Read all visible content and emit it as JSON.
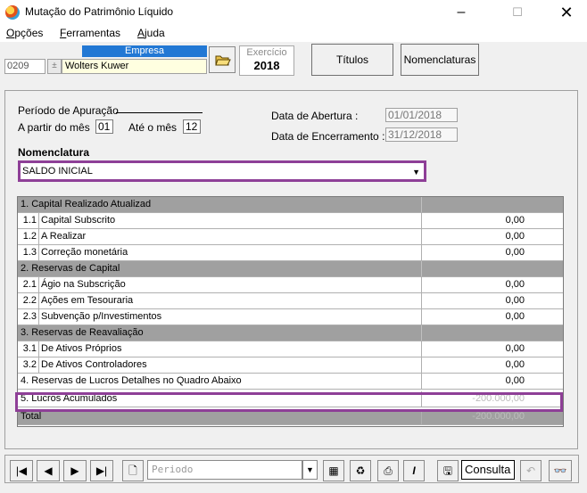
{
  "window": {
    "title": "Mutação do Patrimônio Líquido"
  },
  "menu": {
    "items": [
      "Opções",
      "Ferramentas",
      "Ajuda"
    ],
    "underline_first": [
      "O",
      "F",
      "A"
    ]
  },
  "header": {
    "empresa_label": "Empresa",
    "empresa_code": "0209",
    "empresa_name": "Wolters Kuwer",
    "exercicio_label": "Exercício",
    "exercicio_year": "2018",
    "titulos_label": "Títulos",
    "nomenclaturas_label": "Nomenclaturas"
  },
  "period": {
    "title": "Período de Apuração",
    "from_label": "A partir do mês",
    "from_value": "01",
    "to_label": "Até o mês",
    "to_value": "12"
  },
  "dates": {
    "abertura_label": "Data de Abertura :",
    "abertura_value": "01/01/2018",
    "encerramento_label": "Data de Encerramento :",
    "encerramento_value": "31/12/2018"
  },
  "nomenclatura": {
    "label": "Nomenclatura",
    "selected": "SALDO INICIAL"
  },
  "table": {
    "rows": [
      {
        "type": "group",
        "desc": "1. Capital Realizado Atualizad",
        "amount": ""
      },
      {
        "type": "item",
        "num": "1.1",
        "desc": "Capital Subscrito",
        "amount": "0,00"
      },
      {
        "type": "item",
        "num": "1.2",
        "desc": "A Realizar",
        "amount": "0,00"
      },
      {
        "type": "item",
        "num": "1.3",
        "desc": "Correção monetária",
        "amount": "0,00"
      },
      {
        "type": "group",
        "desc": "2. Reservas  de Capital",
        "amount": ""
      },
      {
        "type": "item",
        "num": "2.1",
        "desc": "Ágio na Subscrição",
        "amount": "0,00"
      },
      {
        "type": "item",
        "num": "2.2",
        "desc": "Ações em Tesouraria",
        "amount": "0,00"
      },
      {
        "type": "item",
        "num": "2.3",
        "desc": "Subvenção p/Investimentos",
        "amount": "0,00"
      },
      {
        "type": "group",
        "desc": "3. Reservas de Reavaliação",
        "amount": ""
      },
      {
        "type": "item",
        "num": "3.1",
        "desc": "De Ativos Próprios",
        "amount": "0,00"
      },
      {
        "type": "item",
        "num": "3.2",
        "desc": "De Ativos Controladores",
        "amount": "0,00"
      },
      {
        "type": "plain",
        "desc": "4. Reservas de Lucros Detalhes no Quadro Abaixo",
        "amount": "0,00"
      },
      {
        "type": "lucros",
        "desc": "5. Lucros Acumulados",
        "amount": "-200.000,00"
      },
      {
        "type": "total",
        "desc": "Total",
        "amount": "-200.000,00"
      }
    ]
  },
  "statusbar": {
    "periodo_placeholder": "Periodo",
    "consulta_label": "Consulta"
  },
  "colors": {
    "highlight": "#8e3f97",
    "group_bg": "#a0a0a0",
    "company_bg": "#ffffe0",
    "header_blue": "#2278d4"
  }
}
